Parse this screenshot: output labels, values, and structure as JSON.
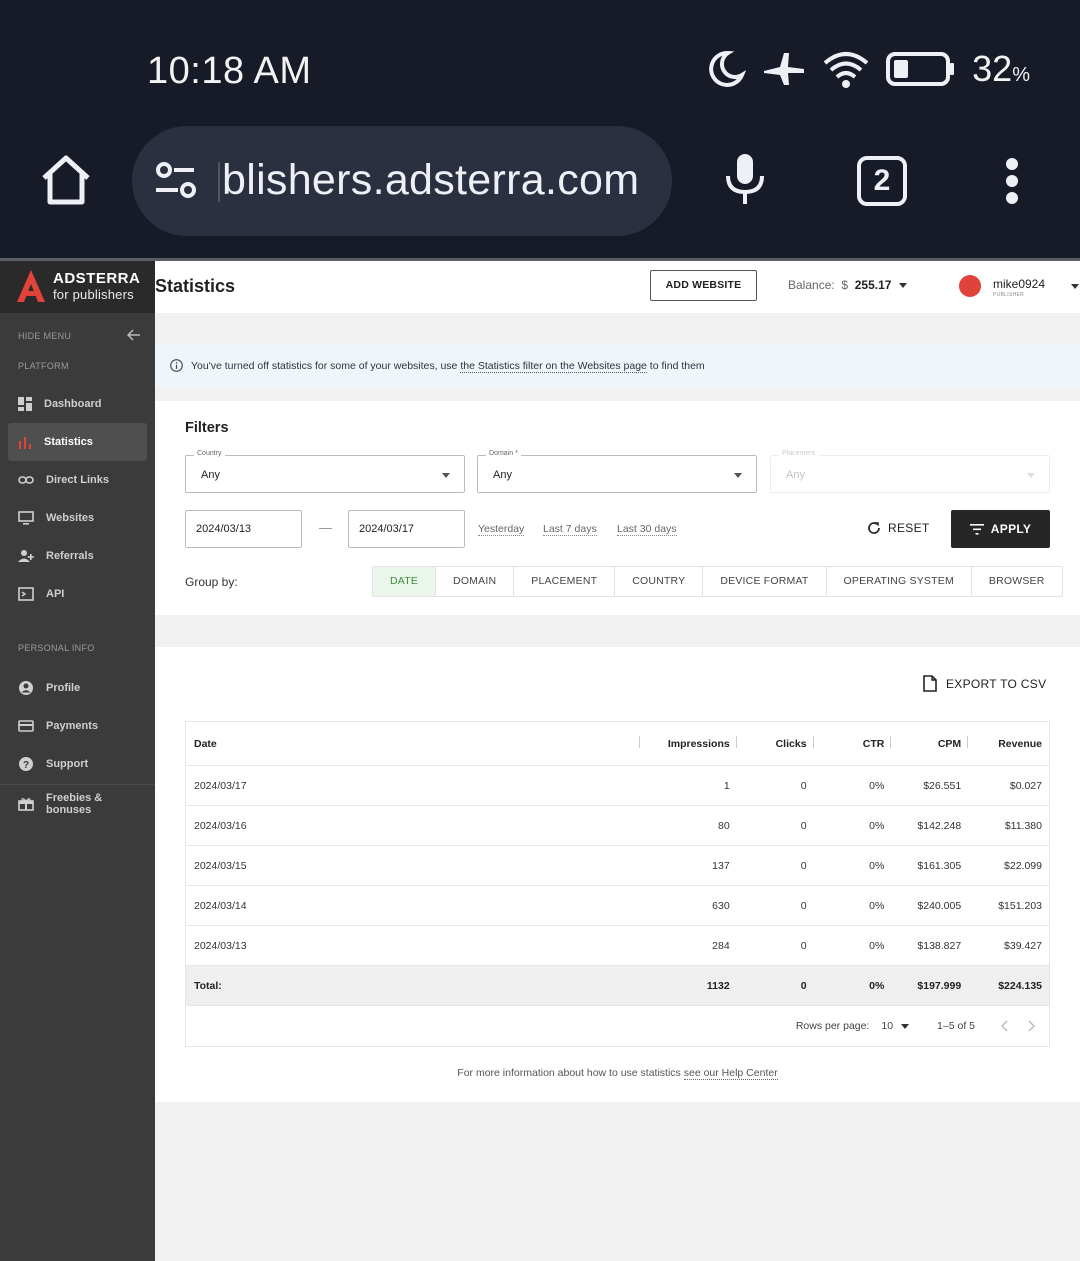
{
  "status_bar": {
    "time": "10:18 AM",
    "battery_pct": "32",
    "battery_unit": "%",
    "icons": [
      "moon-icon",
      "airplane-icon",
      "wifi-icon",
      "battery-icon"
    ]
  },
  "browser": {
    "url": "blishers.adsterra.com",
    "tab_count": "2",
    "icons": [
      "home-icon",
      "tune-icon",
      "mic-icon",
      "more-icon"
    ]
  },
  "brand": {
    "name": "ADSTERRA",
    "tagline": "for publishers",
    "accent": "#e0433a"
  },
  "sidebar": {
    "hide_menu": "HIDE MENU",
    "platform_label": "PLATFORM",
    "platform_items": [
      {
        "label": "Dashboard",
        "icon": "dashboard-icon"
      },
      {
        "label": "Statistics",
        "icon": "statistics-icon",
        "active": true
      },
      {
        "label": "Direct Links",
        "icon": "link-icon"
      },
      {
        "label": "Websites",
        "icon": "monitor-icon"
      },
      {
        "label": "Referrals",
        "icon": "referrals-icon"
      },
      {
        "label": "API",
        "icon": "terminal-icon"
      }
    ],
    "personal_label": "PERSONAL INFO",
    "personal_items": [
      {
        "label": "Profile",
        "icon": "profile-icon"
      },
      {
        "label": "Payments",
        "icon": "card-icon"
      },
      {
        "label": "Support",
        "icon": "help-icon"
      }
    ],
    "extra_items": [
      {
        "label": "Freebies & bonuses",
        "icon": "gift-icon"
      }
    ]
  },
  "header": {
    "title": "Statistics",
    "add_website": "ADD WEBSITE",
    "balance_label": "Balance:",
    "currency": "$",
    "balance_value": "255.17",
    "username": "mike0924",
    "role": "PUBLISHER"
  },
  "notice": {
    "prefix": "You've turned off statistics for some of your websites, use ",
    "link": "the Statistics filter on the Websites page",
    "suffix": " to find them"
  },
  "filters": {
    "title": "Filters",
    "country": {
      "label": "Country",
      "value": "Any"
    },
    "domain": {
      "label": "Domain *",
      "value": "Any"
    },
    "placement": {
      "label": "Placement",
      "value": "Any"
    },
    "date_from": "2024/03/13",
    "date_to": "2024/03/17",
    "quick_ranges": [
      "Yesterday",
      "Last 7 days",
      "Last 30 days"
    ],
    "reset": "RESET",
    "apply": "APPLY",
    "group_by_label": "Group by:",
    "group_by": [
      "DATE",
      "DOMAIN",
      "PLACEMENT",
      "COUNTRY",
      "DEVICE FORMAT",
      "OPERATING SYSTEM",
      "BROWSER"
    ],
    "group_by_active": "DATE"
  },
  "results": {
    "export": "EXPORT TO CSV",
    "columns": [
      "Date",
      "Impressions",
      "Clicks",
      "CTR",
      "CPM",
      "Revenue"
    ],
    "rows": [
      [
        "2024/03/17",
        "1",
        "0",
        "0%",
        "$26.551",
        "$0.027"
      ],
      [
        "2024/03/16",
        "80",
        "0",
        "0%",
        "$142.248",
        "$11.380"
      ],
      [
        "2024/03/15",
        "137",
        "0",
        "0%",
        "$161.305",
        "$22.099"
      ],
      [
        "2024/03/14",
        "630",
        "0",
        "0%",
        "$240.005",
        "$151.203"
      ],
      [
        "2024/03/13",
        "284",
        "0",
        "0%",
        "$138.827",
        "$39.427"
      ]
    ],
    "total": [
      "Total:",
      "1132",
      "0",
      "0%",
      "$197.999",
      "$224.135"
    ],
    "rows_per_page_label": "Rows per page:",
    "rows_per_page": "10",
    "range": "1–5 of 5"
  },
  "help": {
    "prefix": "For more information about how to use statistics ",
    "link": "see our Help Center"
  }
}
